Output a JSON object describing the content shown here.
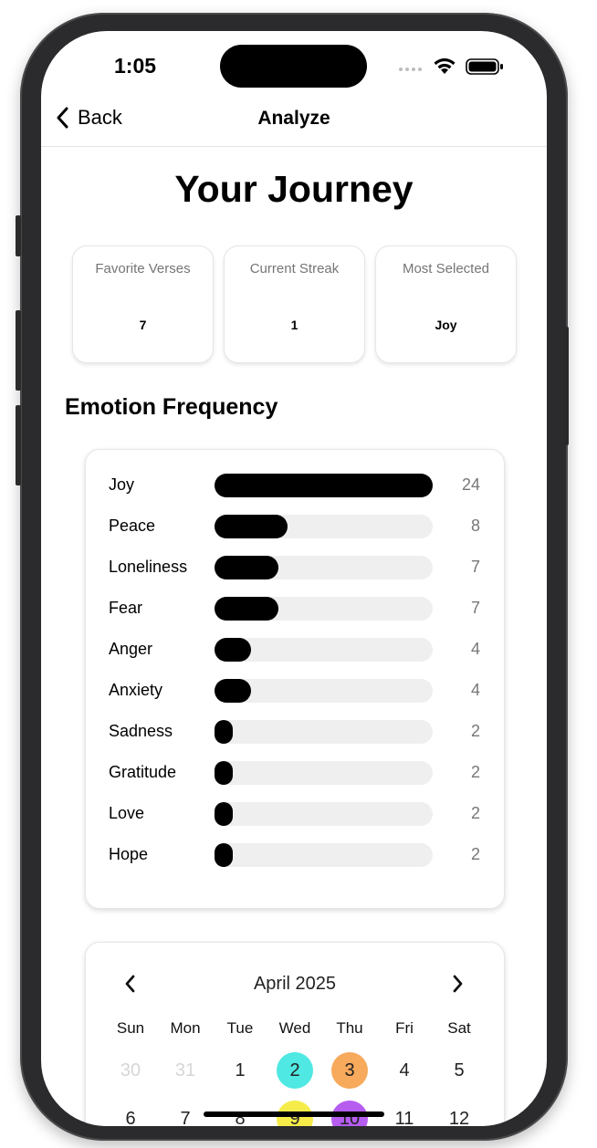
{
  "status_bar": {
    "time": "1:05"
  },
  "nav": {
    "back_label": "Back",
    "title": "Analyze"
  },
  "page_title": "Your Journey",
  "stats": [
    {
      "label": "Favorite Verses",
      "value": "7"
    },
    {
      "label": "Current Streak",
      "value": "1"
    },
    {
      "label": "Most Selected",
      "value": "Joy"
    }
  ],
  "emotion_section": {
    "title": "Emotion Frequency",
    "max": 24,
    "items": [
      {
        "name": "Joy",
        "count": 24
      },
      {
        "name": "Peace",
        "count": 8
      },
      {
        "name": "Loneliness",
        "count": 7
      },
      {
        "name": "Fear",
        "count": 7
      },
      {
        "name": "Anger",
        "count": 4
      },
      {
        "name": "Anxiety",
        "count": 4
      },
      {
        "name": "Sadness",
        "count": 2
      },
      {
        "name": "Gratitude",
        "count": 2
      },
      {
        "name": "Love",
        "count": 2
      },
      {
        "name": "Hope",
        "count": 2
      }
    ]
  },
  "calendar": {
    "month_label": "April 2025",
    "weekdays": [
      "Sun",
      "Mon",
      "Tue",
      "Wed",
      "Thu",
      "Fri",
      "Sat"
    ],
    "weeks": [
      [
        {
          "day": "30",
          "muted": true
        },
        {
          "day": "31",
          "muted": true
        },
        {
          "day": "1"
        },
        {
          "day": "2",
          "color": "#4fe8e2"
        },
        {
          "day": "3",
          "color": "#f7a95c"
        },
        {
          "day": "4"
        },
        {
          "day": "5"
        }
      ],
      [
        {
          "day": "6"
        },
        {
          "day": "7"
        },
        {
          "day": "8"
        },
        {
          "day": "9",
          "color": "#f5ec4a"
        },
        {
          "day": "10",
          "color": "#b65df0"
        },
        {
          "day": "11"
        },
        {
          "day": "12"
        }
      ]
    ]
  },
  "icons": {
    "back": "chevron-left-icon",
    "cal_prev": "chevron-left-icon",
    "cal_next": "chevron-right-icon",
    "wifi": "wifi-icon",
    "battery": "battery-icon",
    "signal": "cellular-signal-icon"
  },
  "colors": {
    "bar_fill": "#000000",
    "bar_track": "#efefef",
    "count_text": "#777777"
  }
}
